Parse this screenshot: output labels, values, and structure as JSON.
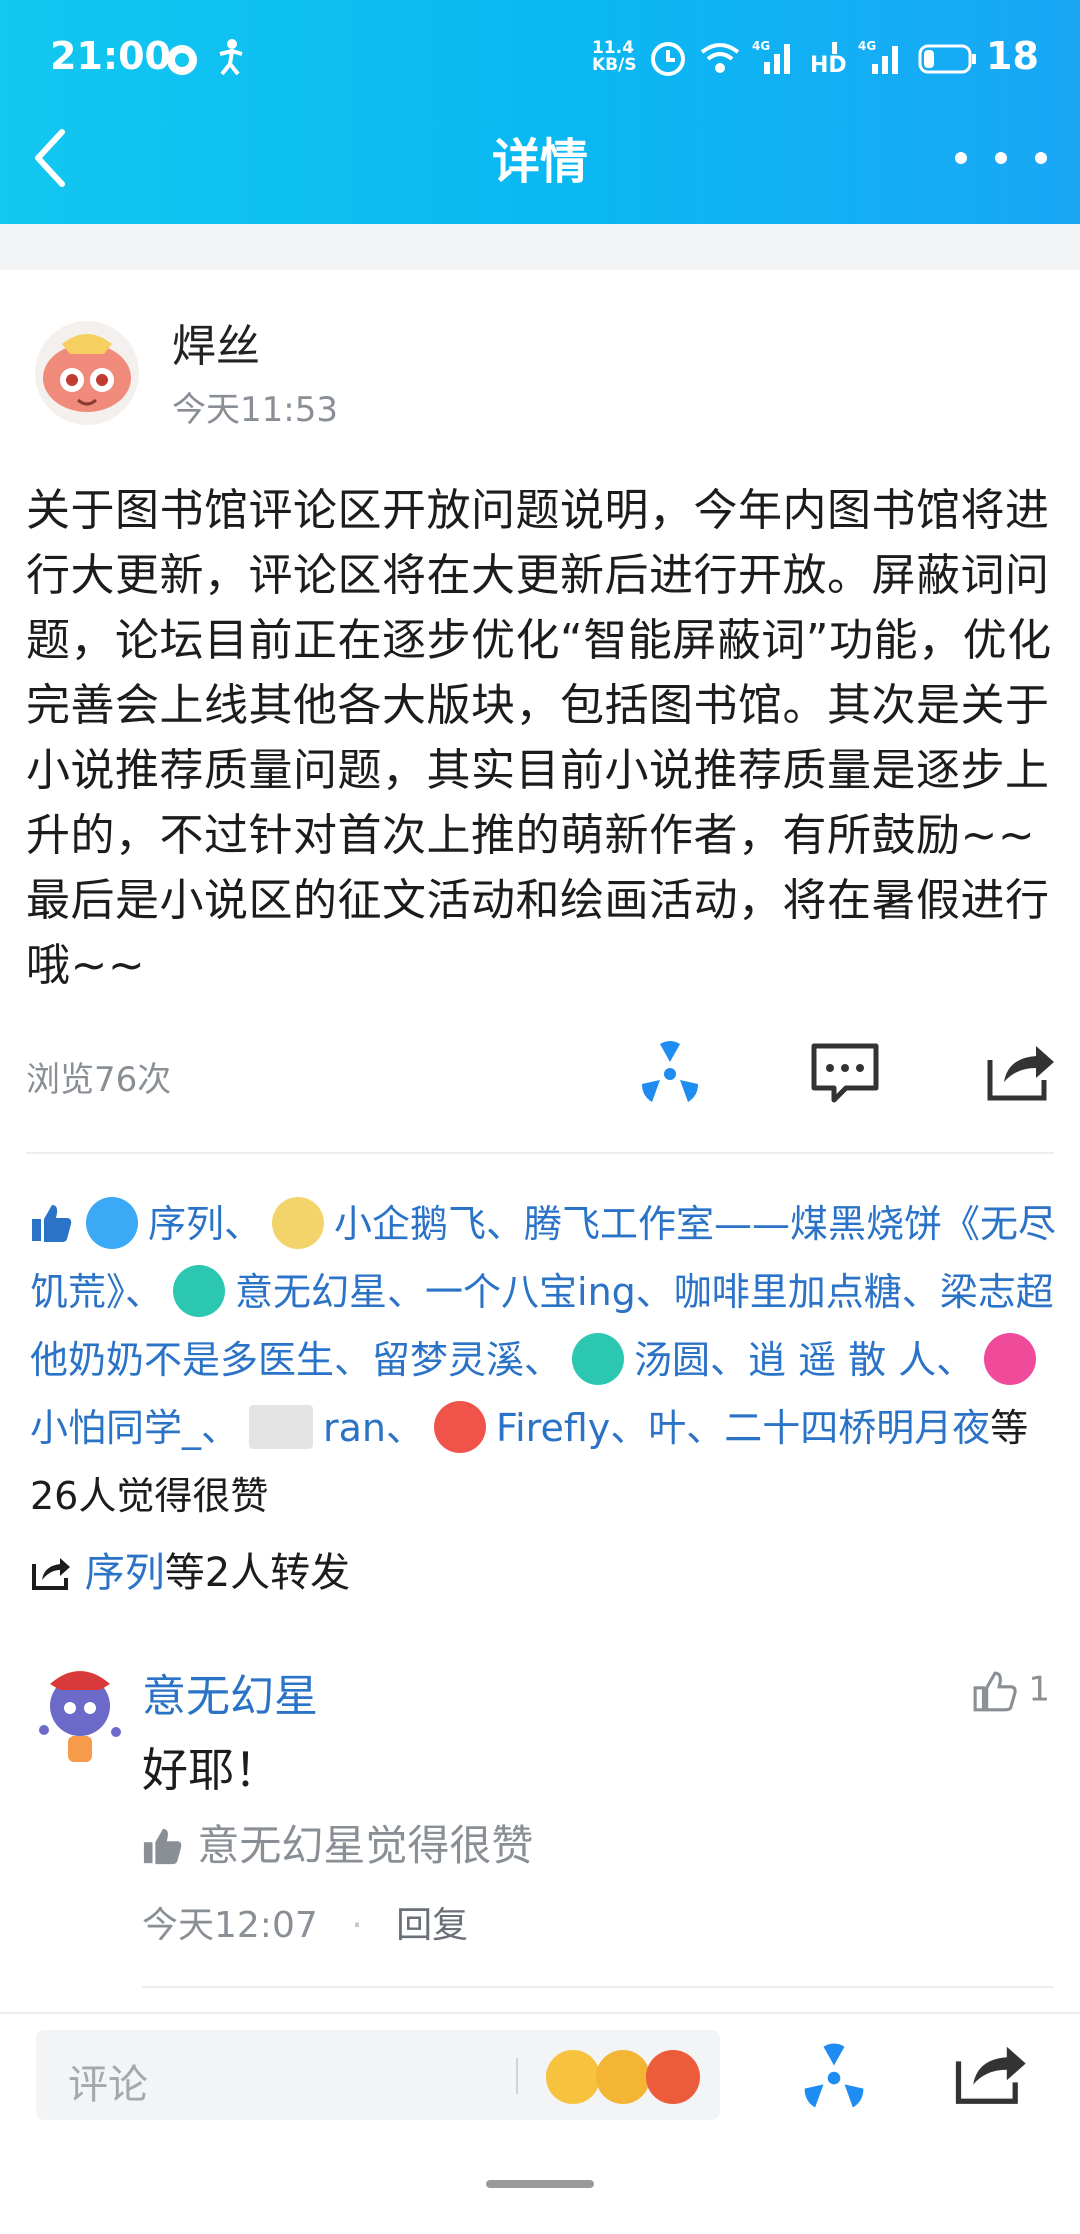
{
  "status_bar": {
    "time": "21:00",
    "net_speed_top": "11.4",
    "net_speed_bottom": "KB/S",
    "battery": "18"
  },
  "nav": {
    "title": "详情"
  },
  "post": {
    "author": "焊丝",
    "time": "今天11:53",
    "content": "关于图书馆评论区开放问题说明，今年内图书馆将进行大更新，评论区将在大更新后进行开放。屏蔽词问题，论坛目前正在逐步优化“智能屏蔽词”功能，优化完善会上线其他各大版块，包括图书馆。其次是关于小说推荐质量问题，其实目前小说推荐质量是逐步上升的，不过针对首次上推的萌新作者，有所鼓励~~最后是小说区的征文活动和绘画活动，将在暑假进行哦~~",
    "views": "浏览76次"
  },
  "likes": {
    "users": [
      {
        "name": "序列、",
        "badge": "#3ba9f5"
      },
      {
        "name": "小企鹅飞、腾飞工作室——煤黑烧饼《无尽饥荒》、",
        "badge": "#f3d46b"
      },
      {
        "name": "意无幻星、一个八宝ing、咖啡里加点糖、梁志超他奶奶不是多医生、留梦灵溪、",
        "badge": "#2cc7b0"
      },
      {
        "name": "汤圆、逍 遥 散 人、",
        "badge": "#2cc7b0"
      },
      {
        "name": "小怕同学_、",
        "badge": "#f04a9a"
      },
      {
        "name": "ran、",
        "badge": "#e8e8e8"
      },
      {
        "name": "Firefly、叶、二十四桥明月夜",
        "badge": "#f0534a"
      }
    ],
    "suffix": "等26人觉得很赞"
  },
  "forward": {
    "user": "序列",
    "suffix": "等2人转发"
  },
  "comment": {
    "name": "意无幻星",
    "like_count": "1",
    "text": "好耶！",
    "liked_by": "意无幻星觉得很赞",
    "time": "今天12:07",
    "reply": "回复"
  },
  "bottom_bar": {
    "placeholder": "评论"
  },
  "colors": {
    "header_start": "#12c7f0",
    "header_end": "#1aa7f5",
    "link": "#2b73c7",
    "icon_blue": "#1e8cf0"
  }
}
